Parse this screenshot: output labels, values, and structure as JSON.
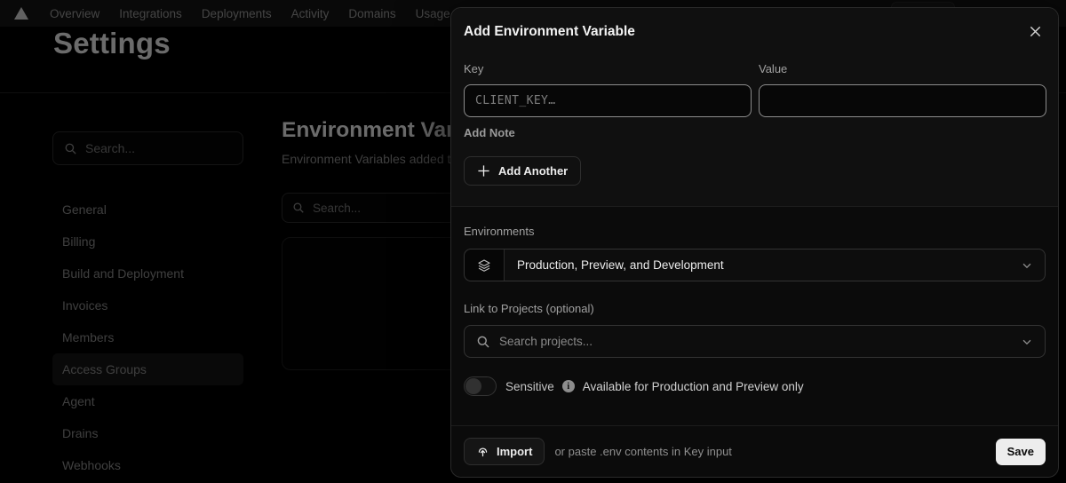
{
  "nav": {
    "items": [
      "Overview",
      "Integrations",
      "Deployments",
      "Activity",
      "Domains",
      "Usage"
    ]
  },
  "page": {
    "title": "Settings"
  },
  "sidebar": {
    "search_placeholder": "Search...",
    "items": [
      "General",
      "Billing",
      "Build and Deployment",
      "Invoices",
      "Members",
      "Access Groups",
      "Agent",
      "Drains",
      "Webhooks"
    ]
  },
  "main": {
    "heading": "Environment Variables",
    "description": "Environment Variables added to th",
    "search_placeholder": "Search..."
  },
  "modal": {
    "title": "Add Environment Variable",
    "key": {
      "label": "Key",
      "placeholder": "CLIENT_KEY…"
    },
    "value": {
      "label": "Value",
      "placeholder": ""
    },
    "add_note_label": "Add Note",
    "add_another_label": "Add Another",
    "environments": {
      "label": "Environments",
      "selected": "Production, Preview, and Development"
    },
    "link_projects": {
      "label": "Link to Projects (optional)",
      "search_placeholder": "Search projects..."
    },
    "sensitive": {
      "label": "Sensitive",
      "note": "Available for Production and Preview only"
    },
    "footer": {
      "import_label": "Import",
      "hint": "or paste .env contents in Key input",
      "save_label": "Save"
    }
  },
  "icons": {
    "logo": "vercel-triangle",
    "search": "magnifier",
    "close": "x",
    "environments": "layers-stack",
    "chevron": "chevron-down",
    "info": "circled-i",
    "import": "upload-arrow",
    "add": "plus"
  },
  "colors": {
    "page_bg": "#000000",
    "modal_bg": "#0b0b0b",
    "modal_top_bg": "#101010",
    "save_button_bg": "#ededed",
    "focused_input_border": "#8c8c8c",
    "muted_text": "#a1a1a1"
  }
}
